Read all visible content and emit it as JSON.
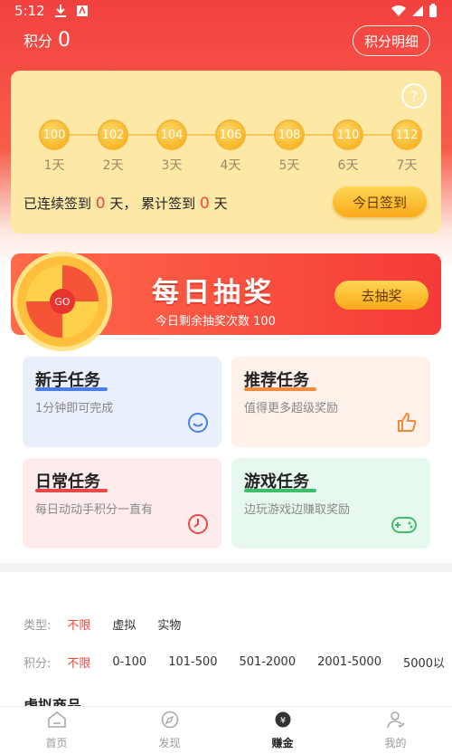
{
  "status_bar": {
    "time": "5:12"
  },
  "header": {
    "points_label": "积分",
    "points_value": "0",
    "detail_button": "积分明细"
  },
  "signin": {
    "days": [
      {
        "points": "100",
        "label": "1天"
      },
      {
        "points": "102",
        "label": "2天"
      },
      {
        "points": "104",
        "label": "3天"
      },
      {
        "points": "106",
        "label": "4天"
      },
      {
        "points": "108",
        "label": "5天"
      },
      {
        "points": "110",
        "label": "6天"
      },
      {
        "points": "112",
        "label": "7天"
      }
    ],
    "streak_prefix": "已连续签到",
    "streak_days": "0",
    "streak_mid": "天， 累计签到",
    "total_days": "0",
    "streak_suffix": "天",
    "button": "今日签到"
  },
  "lottery": {
    "title": "每日抽奖",
    "remaining": "今日剩余抽奖次数 100",
    "button": "去抽奖",
    "wheel_center": "GO"
  },
  "tasks": [
    {
      "title": "新手任务",
      "desc": "1分钟即可完成",
      "icon": "smile-icon",
      "bg": "#e9f0fc",
      "accent": "#4a7ee8"
    },
    {
      "title": "推荐任务",
      "desc": "值得更多超级奖励",
      "icon": "thumb-up-icon",
      "bg": "#fdf1ea",
      "accent": "#f08a3c"
    },
    {
      "title": "日常任务",
      "desc": "每日动动手积分一直有",
      "icon": "clock-icon",
      "bg": "#fdeceb",
      "accent": "#e84a4a"
    },
    {
      "title": "游戏任务",
      "desc": "边玩游戏边赚取奖励",
      "icon": "gamepad-icon",
      "bg": "#e7f9ee",
      "accent": "#3fbf6b"
    }
  ],
  "filters": {
    "type_label": "类型:",
    "type_options": [
      "不限",
      "虚拟",
      "实物"
    ],
    "points_label": "积分:",
    "points_options": [
      "不限",
      "0-100",
      "101-500",
      "501-2000",
      "2001-5000",
      "5000以"
    ]
  },
  "section_title": "虚拟商品",
  "tabbar": [
    {
      "label": "首页",
      "icon": "home-icon"
    },
    {
      "label": "发现",
      "icon": "compass-icon"
    },
    {
      "label": "赚金",
      "icon": "earn-icon"
    },
    {
      "label": "我的",
      "icon": "user-icon"
    }
  ]
}
